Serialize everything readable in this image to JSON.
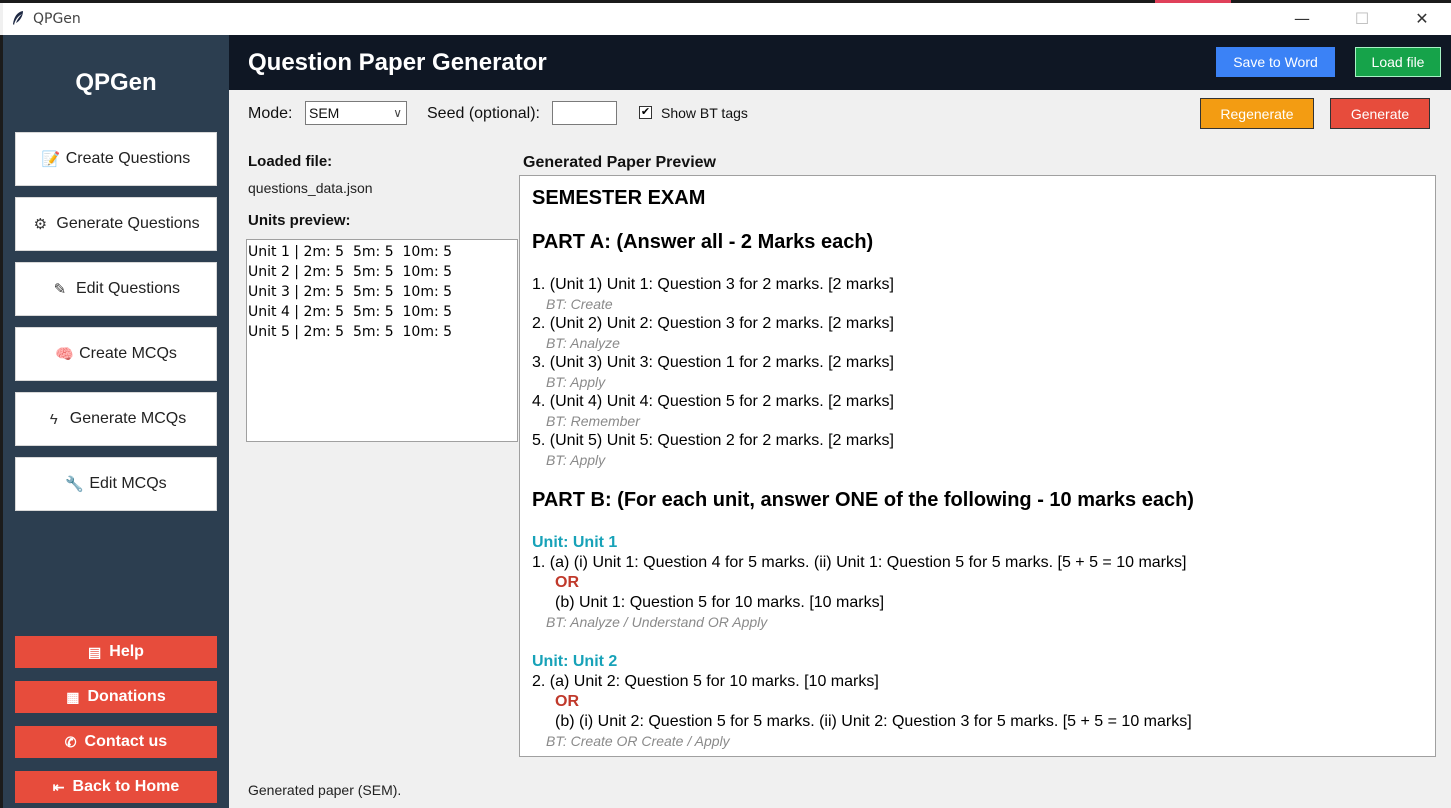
{
  "window": {
    "title": "QPGen",
    "min_glyph": "—",
    "max_glyph": "☐",
    "close_glyph": "✕"
  },
  "sidebar": {
    "brand": "QPGen",
    "nav": [
      {
        "label": "Create Questions",
        "icon": "document-edit-icon",
        "glyph": "📝"
      },
      {
        "label": "Generate Questions",
        "icon": "gear-icon",
        "glyph": "⚙"
      },
      {
        "label": "Edit Questions",
        "icon": "pencil-icon",
        "glyph": "✎"
      },
      {
        "label": "Create MCQs",
        "icon": "brain-icon",
        "glyph": "🧠"
      },
      {
        "label": "Generate MCQs",
        "icon": "lightning-icon",
        "glyph": "ϟ"
      },
      {
        "label": "Edit MCQs",
        "icon": "wrench-icon",
        "glyph": "🔧"
      }
    ],
    "actions": [
      {
        "label": "Help",
        "icon": "bus-icon",
        "glyph": "▤"
      },
      {
        "label": "Donations",
        "icon": "gift-icon",
        "glyph": "▦"
      },
      {
        "label": "Contact us",
        "icon": "phone-icon",
        "glyph": "✆"
      },
      {
        "label": "Back to Home",
        "icon": "back-arrow-icon",
        "glyph": "⇤"
      }
    ]
  },
  "header": {
    "title": "Question Paper Generator",
    "save_label": "Save to Word",
    "load_label": "Load file",
    "save_color": "#3b82f6",
    "load_color": "#16a34a"
  },
  "toolbar": {
    "mode_label": "Mode:",
    "mode_value": "SEM",
    "mode_chevron": "∨",
    "seed_label": "Seed (optional):",
    "seed_value": "",
    "show_bt_checked": "✔",
    "show_bt_label": "Show BT tags",
    "regenerate_label": "Regenerate",
    "generate_label": "Generate",
    "regenerate_color": "#f39c12",
    "generate_color": "#e74c3c"
  },
  "left": {
    "loaded_file_label": "Loaded file:",
    "loaded_file_name": "questions_data.json",
    "units_preview_label": "Units preview:",
    "units": [
      "Unit 1 | 2m: 5  5m: 5  10m: 5",
      "Unit 2 | 2m: 5  5m: 5  10m: 5",
      "Unit 3 | 2m: 5  5m: 5  10m: 5",
      "Unit 4 | 2m: 5  5m: 5  10m: 5",
      "Unit 5 | 2m: 5  5m: 5  10m: 5"
    ]
  },
  "preview": {
    "label": "Generated Paper Preview",
    "exam_title": "SEMESTER EXAM",
    "part_a_heading": "PART A: (Answer all - 2 Marks each)",
    "part_a": [
      {
        "q": "1. (Unit 1) Unit 1: Question 3 for 2 marks.  [2 marks]",
        "bt": "BT: Create"
      },
      {
        "q": "2. (Unit 2) Unit 2: Question 3 for 2 marks.  [2 marks]",
        "bt": "BT: Analyze"
      },
      {
        "q": "3. (Unit 3) Unit 3: Question 1 for 2 marks.  [2 marks]",
        "bt": "BT: Apply"
      },
      {
        "q": "4. (Unit 4) Unit 4: Question 5 for 2 marks.  [2 marks]",
        "bt": "BT: Remember"
      },
      {
        "q": "5. (Unit 5) Unit 5: Question 2 for 2 marks.  [2 marks]",
        "bt": "BT: Apply"
      }
    ],
    "part_b_heading": "PART B: (For each unit, answer ONE of the following - 10 marks each)",
    "part_b": [
      {
        "unit": "Unit: Unit 1",
        "a": "1. (a) (i) Unit 1: Question 4 for 5 marks.  (ii) Unit 1: Question 5 for 5 marks.  [5 + 5 = 10 marks]",
        "or": "OR",
        "b": "(b) Unit 1: Question 5 for 10 marks.  [10 marks]",
        "bt": "BT: Analyze / Understand   OR   Apply"
      },
      {
        "unit": "Unit: Unit 2",
        "a": "2. (a) Unit 2: Question 5 for 10 marks.  [10 marks]",
        "or": "OR",
        "b": "(b) (i) Unit 2: Question 5 for 5 marks.  (ii) Unit 2: Question 3 for 5 marks.  [5 + 5 = 10 marks]",
        "bt": "BT: Create   OR   Create / Apply"
      }
    ]
  },
  "status": "Generated paper (SEM).",
  "colors": {
    "sidebar_bg": "#2c3e50",
    "header_bg": "#0f1724",
    "action_red": "#e74c3c",
    "unit_teal": "#17a2b8",
    "or_red": "#c0392b"
  }
}
